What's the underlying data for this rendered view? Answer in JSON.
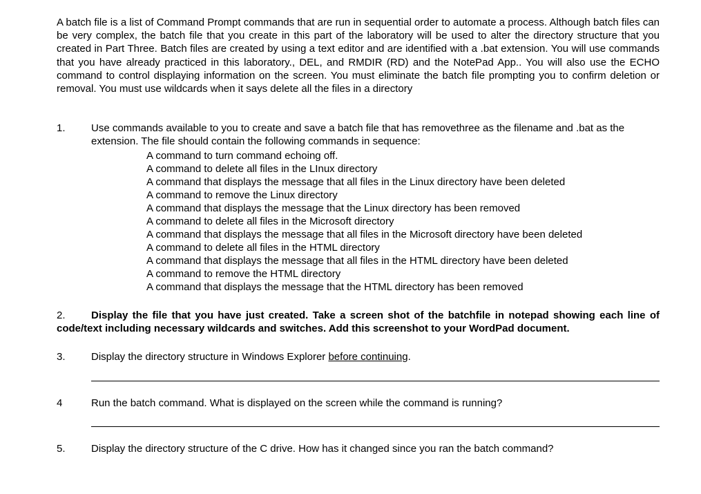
{
  "intro": "A batch file is a list of Command Prompt commands that are run in sequential order to automate a process.  Although batch files can be very complex, the batch file that you create in this part of the laboratory will be used to alter the directory structure that you created in Part Three.  Batch files are created by using a text editor and are identified with a .bat extension.  You will use commands that you have already practiced in this laboratory., DEL, and RMDIR (RD) and the NotePad App.. You will also use the ECHO command to control displaying information on the screen. You must eliminate the batch file prompting you to confirm deletion or removal. You must use wildcards when it says delete all the files in a directory",
  "steps": {
    "s1": {
      "num": "1.",
      "lead": "Use commands available to you to create and save a batch file that has removethree as the filename and .bat as the extension. The file should contain the following commands in sequence:",
      "items": [
        "A command to turn command echoing off.",
        "A command to delete all files in the LInux directory",
        "A command that displays the message that all files in the Linux directory have been deleted",
        "A command to remove the Linux directory",
        "A command that displays the message that the Linux directory has been removed",
        "A command to delete all files in the Microsoft directory",
        "A command that displays the message that all files in the Microsoft directory have been deleted",
        "A command to delete all files in the HTML directory",
        "A command that displays the message that all files in the HTML directory have been deleted",
        "A command to remove the HTML directory",
        "A command that displays the message that the HTML directory has been removed"
      ]
    },
    "s2": {
      "num": "2.",
      "text": "Display the file that you have just created. Take a screen shot of the batchfile in notepad showing each line of code/text including necessary wildcards and switches. Add this screenshot to your WordPad document."
    },
    "s3": {
      "num": "3.",
      "pre": "Display the directory structure in Windows Explorer ",
      "u": "before continuing",
      "post": "."
    },
    "s4": {
      "num": "4",
      "text": "Run the batch command.  What is displayed on the screen while the command is running?"
    },
    "s5": {
      "num": "5.",
      "text": "Display the directory structure of the C drive.  How has it changed since you ran the batch command?"
    }
  }
}
